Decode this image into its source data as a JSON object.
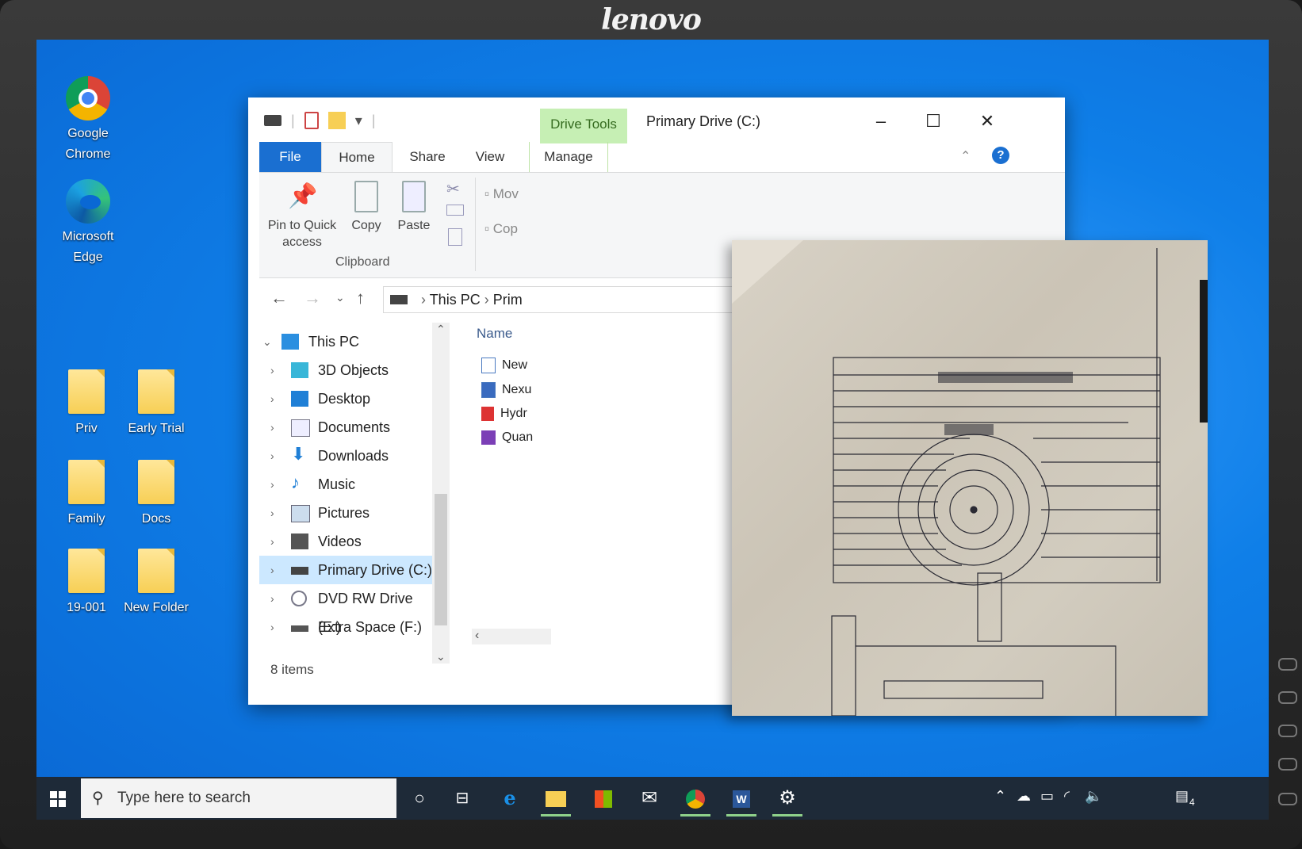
{
  "monitor": {
    "brand": "lenovo"
  },
  "desktop": {
    "icons": [
      {
        "label": "Google Chrome",
        "icon": "chrome-icon"
      },
      {
        "label": "Microsoft Edge",
        "icon": "edge-icon"
      },
      {
        "label": "Priv",
        "icon": "folder-icon"
      },
      {
        "label": "Early Trial",
        "icon": "folder-icon"
      },
      {
        "label": "Family",
        "icon": "folder-icon"
      },
      {
        "label": "Docs",
        "icon": "folder-icon"
      },
      {
        "label": "19-001",
        "icon": "folder-icon"
      },
      {
        "label": "New Folder",
        "icon": "folder-icon"
      }
    ]
  },
  "explorer": {
    "contextual_tab_group": "Drive Tools",
    "title": "Primary Drive (C:)",
    "tabs": [
      "File",
      "Home",
      "Share",
      "View",
      "Manage"
    ],
    "ribbon": {
      "pin_label": "Pin to Quick access",
      "copy_label": "Copy",
      "paste_label": "Paste",
      "move_label": "Mov",
      "copyto_label": "Cop",
      "clipboard_group": "Clipboard"
    },
    "address": {
      "segments": [
        "This PC",
        "Prim"
      ]
    },
    "nav": [
      {
        "label": "This PC",
        "icon": "computer-icon"
      },
      {
        "label": "3D Objects",
        "icon": "cube-icon"
      },
      {
        "label": "Desktop",
        "icon": "desktop-icon"
      },
      {
        "label": "Documents",
        "icon": "documents-icon"
      },
      {
        "label": "Downloads",
        "icon": "download-arrow-icon"
      },
      {
        "label": "Music",
        "icon": "music-note-icon"
      },
      {
        "label": "Pictures",
        "icon": "pictures-icon"
      },
      {
        "label": "Videos",
        "icon": "film-icon"
      },
      {
        "label": "Primary Drive (C:)",
        "icon": "drive-icon"
      },
      {
        "label": "DVD RW Drive (E:)",
        "icon": "dvd-icon"
      },
      {
        "label": "Extra Space (F:)",
        "icon": "drive-icon"
      }
    ],
    "column_header": "Name",
    "files": [
      {
        "name": "New",
        "icon": "image-file-icon"
      },
      {
        "name": "Nexu",
        "icon": "image-file-icon"
      },
      {
        "name": "Hydr",
        "icon": "pdf-file-icon"
      },
      {
        "name": "Quan",
        "icon": "onenote-file-icon"
      }
    ],
    "status": "8 items"
  },
  "taskbar": {
    "search_placeholder": "Type here to search",
    "notification_count": "4"
  }
}
